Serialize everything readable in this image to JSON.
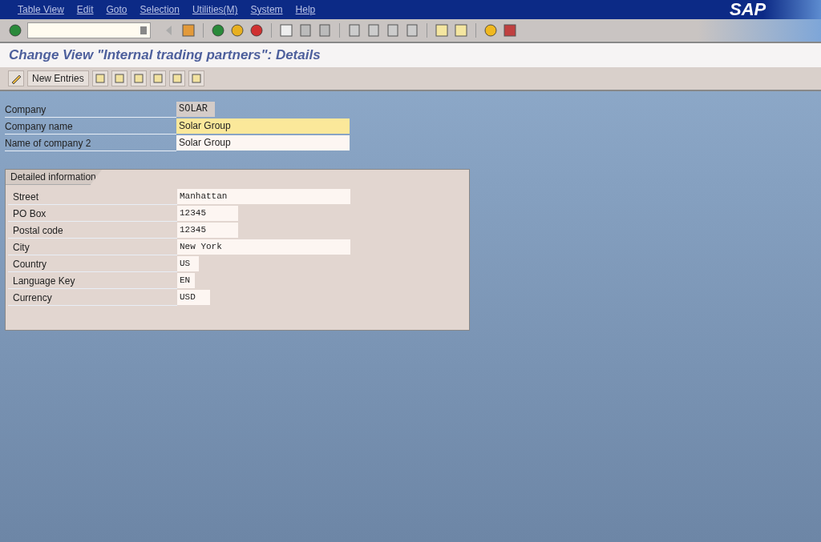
{
  "menu_bar": {
    "items": [
      "Table View",
      "Edit",
      "Goto",
      "Selection",
      "Utilities(M)",
      "System",
      "Help"
    ]
  },
  "logo": "SAP",
  "title": "Change View \"Internal trading partners\": Details",
  "app_toolbar": {
    "buttons": [
      "New Entries"
    ]
  },
  "header_fields": [
    {
      "label": "Company",
      "value": "SOLAR",
      "kind": "display",
      "focused": false
    },
    {
      "label": "Company name",
      "value": "Solar Group",
      "kind": "input",
      "focused": true
    },
    {
      "label": "Name of company 2",
      "value": "Solar Group",
      "kind": "input",
      "focused": false
    }
  ],
  "group": {
    "title": "Detailed information",
    "fields": [
      {
        "label": "Street",
        "value": "Manhattan"
      },
      {
        "label": "PO Box",
        "value": "12345"
      },
      {
        "label": "Postal code",
        "value": "12345"
      },
      {
        "label": "City",
        "value": "New York"
      },
      {
        "label": "Country",
        "value": "US"
      },
      {
        "label": "Language Key",
        "value": "EN"
      },
      {
        "label": "Currency",
        "value": "USD"
      }
    ]
  }
}
